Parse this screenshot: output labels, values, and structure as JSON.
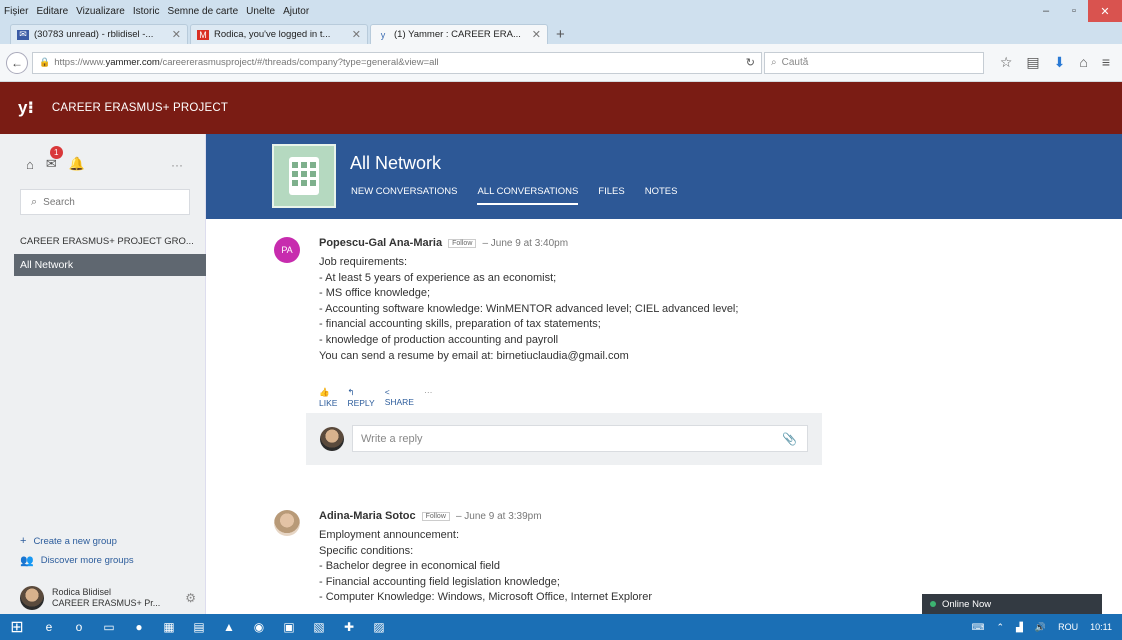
{
  "menu": [
    "Fișier",
    "Editare",
    "Vizualizare",
    "Istoric",
    "Semne de carte",
    "Unelte",
    "Ajutor"
  ],
  "window_controls": {
    "minimize": "–",
    "maximize": "▫",
    "close": "✕"
  },
  "tabs": [
    {
      "icon": "envelope-icon",
      "color": "#3b5ba5",
      "label": "(30783 unread) - rblidisel -..."
    },
    {
      "icon": "gmail-icon",
      "color": "#d93025",
      "label": "Rodica, you've logged in t..."
    },
    {
      "icon": "yammer-icon",
      "color": "#396ab1",
      "label": "(1) Yammer : CAREER ERA..."
    }
  ],
  "address": {
    "prefix": "https://www.",
    "host": "yammer.com",
    "path": "/careererasmusproject/#/threads/company?type=general&view=all"
  },
  "search_placeholder": "Caută",
  "app": {
    "logo": "y⁝",
    "title": "CAREER ERASMUS+ PROJECT",
    "header_color": "#7a1c14"
  },
  "sidebar": {
    "badge": "1",
    "more": "···",
    "search_placeholder": "Search",
    "group_label": "CAREER ERASMUS+ PROJECT GRO...",
    "selected": "All Network",
    "create_group": "Create a new group",
    "discover_groups": "Discover more groups",
    "user_name": "Rodica Blidisel",
    "user_group": "CAREER ERASMUS+ Pr..."
  },
  "group": {
    "title": "All Network",
    "tabs": [
      "NEW CONVERSATIONS",
      "ALL CONVERSATIONS",
      "FILES",
      "NOTES"
    ],
    "active_tab": "ALL CONVERSATIONS",
    "header_color": "#2d5896"
  },
  "posts": [
    {
      "initials": "PA",
      "author": "Popescu-Gal Ana-Maria",
      "follow": "Follow",
      "date": "– June 9 at 3:40pm",
      "lines": [
        "Job requirements:",
        "- At least 5 years of experience as an economist;",
        "- MS office knowledge;",
        "- Accounting software knowledge: WinMENTOR advanced level; CIEL advanced level;",
        "- financial accounting skills, preparation of tax statements;",
        "- knowledge of production accounting and payroll",
        "You can send a resume by email at: birnetiuclaudia@gmail.com"
      ],
      "actions": {
        "like": "LIKE",
        "reply": "REPLY",
        "share": "SHARE",
        "more": "···"
      },
      "reply_placeholder": "Write a reply"
    },
    {
      "author": "Adina-Maria Sotoc",
      "follow": "Follow",
      "date": "– June 9 at 3:39pm",
      "lines": [
        "Employment announcement:",
        "Specific conditions:",
        "- Bachelor degree in economical field",
        "- Financial accounting field legislation knowledge;",
        "- Computer Knowledge: Windows, Microsoft Office, Internet Explorer"
      ]
    }
  ],
  "online_now": "Online Now",
  "taskbar": {
    "lang": "ROU",
    "time": "10:11"
  }
}
